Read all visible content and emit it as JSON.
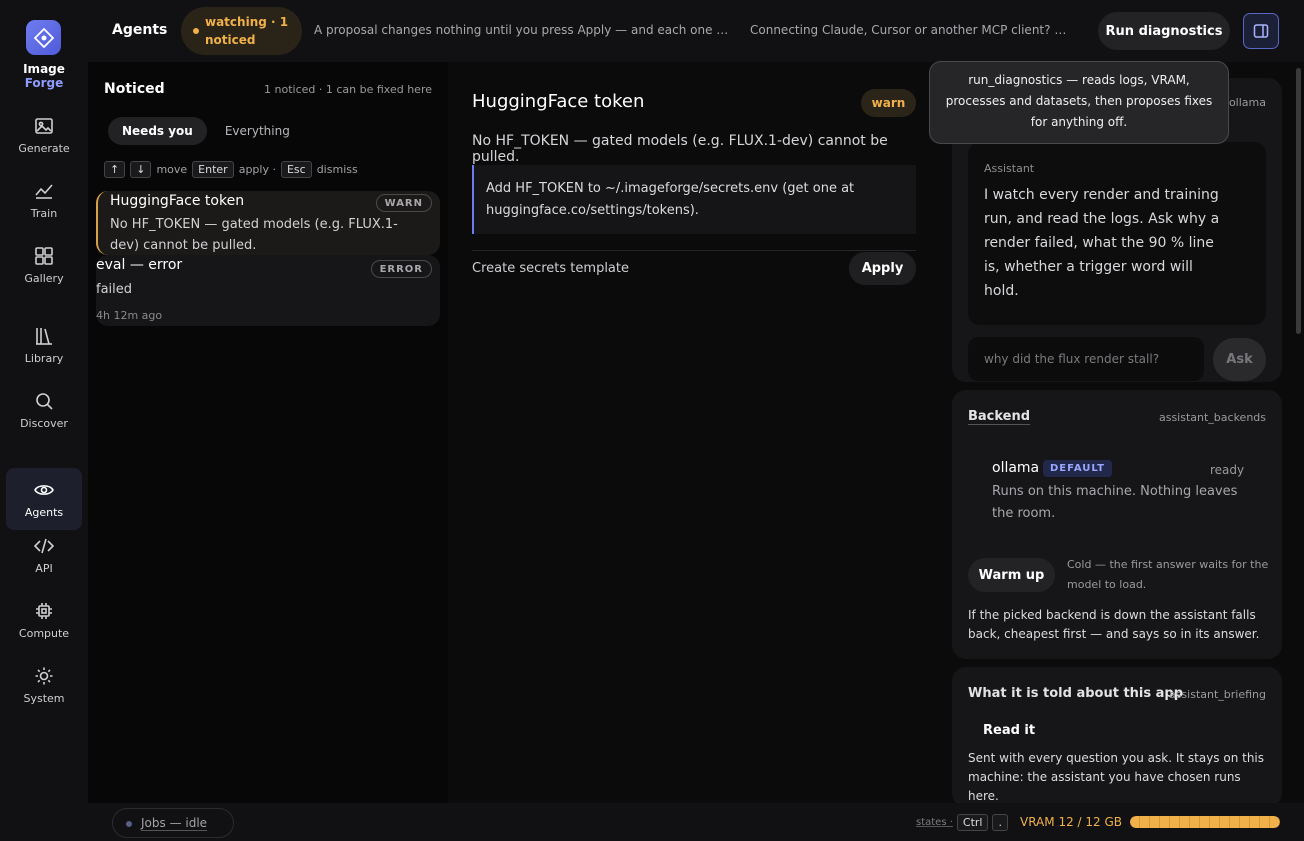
{
  "brand": {
    "line1": "Image",
    "line2": "Forge"
  },
  "nav": [
    {
      "label": "Generate",
      "icon": "image-icon"
    },
    {
      "label": "Train",
      "icon": "chart-line-icon"
    },
    {
      "label": "Gallery",
      "icon": "grid-icon"
    },
    {
      "label": "Library",
      "icon": "books-icon"
    },
    {
      "label": "Discover",
      "icon": "search-icon"
    },
    {
      "label": "Agents",
      "icon": "eye-icon",
      "active": true
    },
    {
      "label": "API",
      "icon": "code-icon"
    },
    {
      "label": "Compute",
      "icon": "chip-icon"
    },
    {
      "label": "System",
      "icon": "sun-gear-icon"
    }
  ],
  "topbar": {
    "title": "Agents",
    "watching": "watching · 1 noticed",
    "tip1": "A proposal changes nothing until you press Apply — and each one stat...",
    "tip2": "Connecting Claude, Cursor or another MCP client? T...",
    "run_label": "Run diagnostics"
  },
  "noticed": {
    "title": "Noticed",
    "count": "1 noticed · 1 can be fixed here",
    "tabs": [
      "Needs you",
      "Everything"
    ],
    "keys": {
      "up": "↑",
      "down": "↓",
      "move": "move",
      "enter": "Enter",
      "apply": "apply ·",
      "esc": "Esc",
      "dismiss": "dismiss"
    },
    "items": [
      {
        "title": "HuggingFace token",
        "tag": "WARN",
        "body": "No HF_TOKEN — gated models (e.g. FLUX.1-dev) cannot be pulled."
      },
      {
        "title": "eval — error",
        "tag": "ERROR",
        "body": "failed",
        "time": "4h 12m ago"
      }
    ]
  },
  "detail": {
    "title": "HuggingFace token",
    "severity": "warn",
    "desc": "No HF_TOKEN — gated models (e.g. FLUX.1-dev) cannot be pulled.",
    "fix": "Add HF_TOKEN to ~/.imageforge/secrets.env (get one at huggingface.co/settings/tokens).",
    "action": "Create secrets template",
    "apply_label": "Apply"
  },
  "tooltip": "run_diagnostics — reads logs, VRAM, processes and datasets, then proposes fixes for anything off.",
  "assistant": {
    "backend_tag": "ollama",
    "label": "Assistant",
    "text": "I watch every render and training run, and read the logs. Ask why a render failed, what the 90 % line is, whether a trigger word will hold.",
    "placeholder": "why did the flux render stall?",
    "ask_label": "Ask"
  },
  "backend": {
    "heading": "Backend",
    "tag": "assistant_backends",
    "name": "ollama",
    "badge": "DEFAULT",
    "state": "ready",
    "desc": "Runs on this machine. Nothing leaves the room.",
    "warm_label": "Warm up",
    "warm_note": "Cold — the first answer waits for the model to load.",
    "fallback": "If the picked backend is down the assistant falls back, cheapest first — and says so in its answer."
  },
  "briefing": {
    "heading": "What it is told about this app",
    "tag": "assistant_briefing",
    "read_label": "Read it",
    "text": "Sent with every question you ask. It stays on this machine: the assistant you have chosen runs here."
  },
  "status": {
    "jobs": "Jobs — idle",
    "states": "states ·",
    "ctrl": "Ctrl",
    "dot": ".",
    "vram": "VRAM 12 / 12 GB",
    "vram_fraction": 1.0
  },
  "colors": {
    "accent": "#6f7cf0",
    "warn": "#f0b04a"
  }
}
